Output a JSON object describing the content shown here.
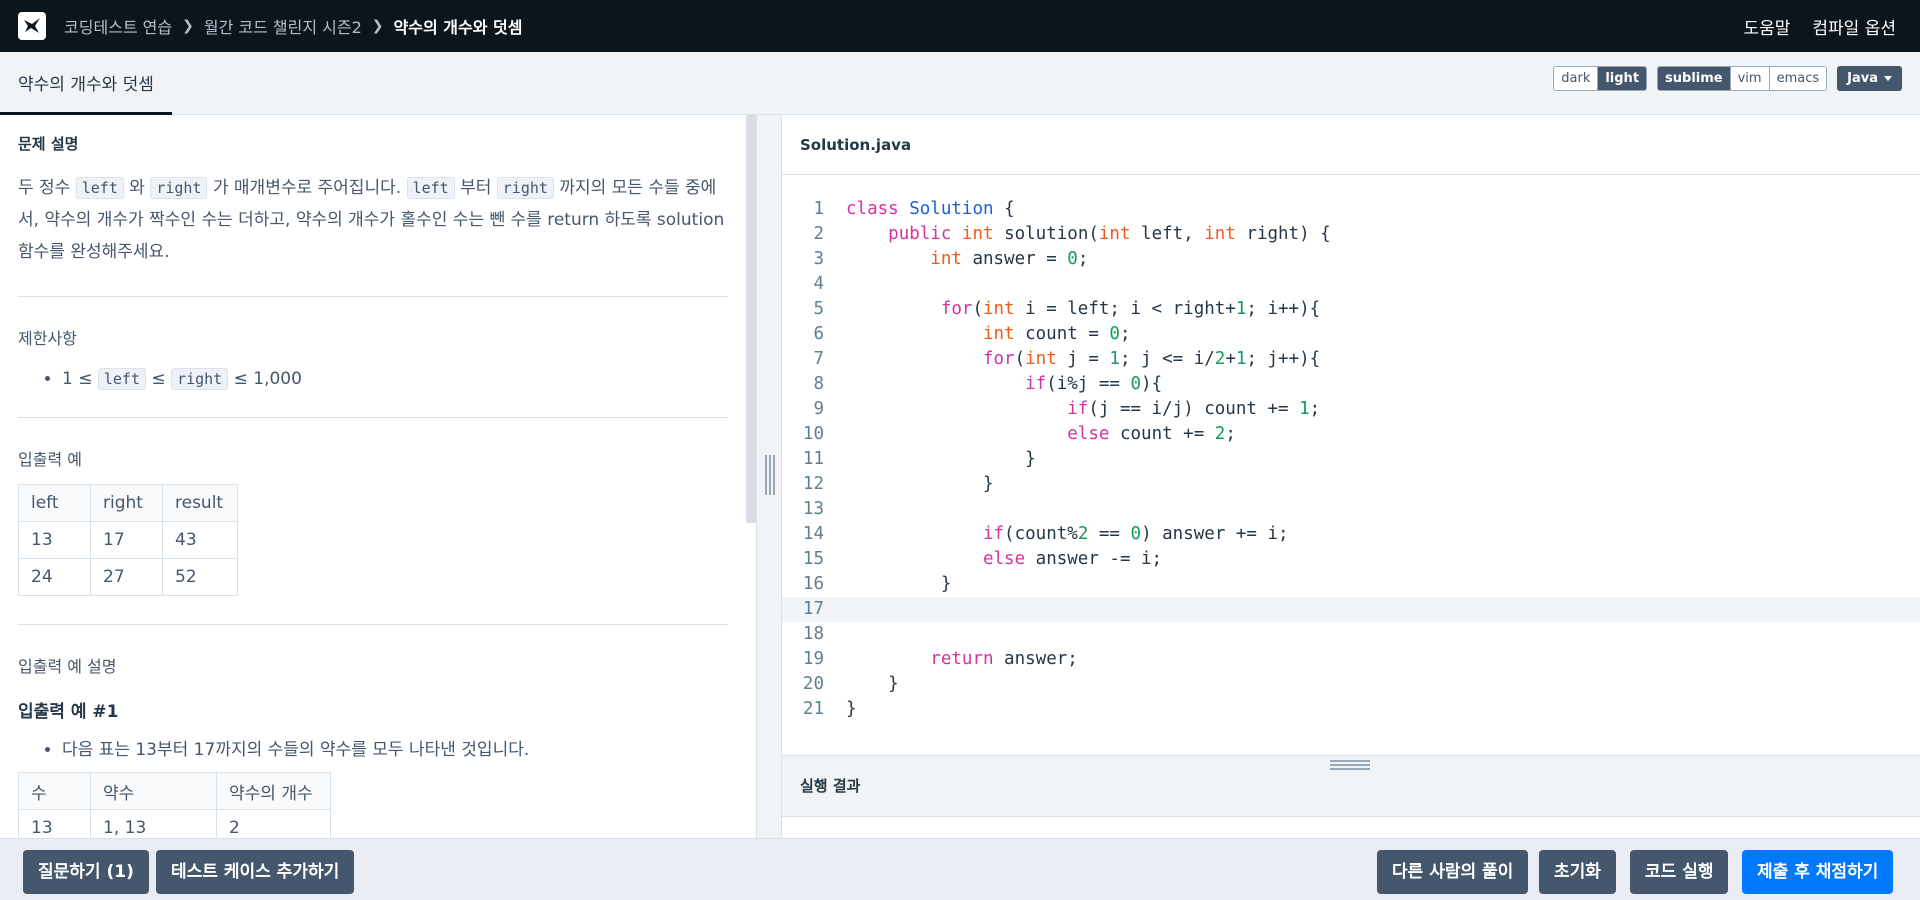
{
  "nav": {
    "crumbs": [
      "코딩테스트 연습",
      "월간 코드 챌린지 시즌2",
      "약수의 개수와 덧셈"
    ],
    "help": "도움말",
    "compile_options": "컴파일 옵션"
  },
  "tabbar": {
    "active_tab": "약수의 개수와 덧셈",
    "themes": [
      "dark",
      "light"
    ],
    "keymaps": [
      "sublime",
      "vim",
      "emacs"
    ],
    "language": "Java"
  },
  "problem": {
    "section_title": "문제 설명",
    "desc": {
      "p1": "두 정수",
      "c1": "left",
      "p2": "와",
      "c2": "right",
      "p3": "가 매개변수로 주어집니다.",
      "c3": "left",
      "p4": "부터",
      "c4": "right",
      "p5": "까지의 모든 수들 중에서, 약수의 개수가 짝수인 수는 더하고, 약수의 개수가 홀수인 수는 뺀 수를 return 하도록 solution 함수를 완성해주세요."
    },
    "constraints_title": "제한사항",
    "constraint": {
      "a": "1 ≤",
      "c1": "left",
      "b": "≤",
      "c2": "right",
      "c": "≤ 1,000"
    },
    "io_title": "입출력 예",
    "io_table": [
      [
        "left",
        "right",
        "result"
      ],
      [
        "13",
        "17",
        "43"
      ],
      [
        "24",
        "27",
        "52"
      ]
    ],
    "io_desc_title": "입출력 예 설명",
    "example1_title": "입출력 예 #1",
    "example1_bullet": "다음 표는 13부터 17까지의 수들의 약수를 모두 나타낸 것입니다.",
    "div_table": [
      [
        "수",
        "약수",
        "약수의 개수"
      ],
      [
        "13",
        "1, 13",
        "2"
      ]
    ]
  },
  "editor": {
    "filename": "Solution.java",
    "line_numbers": [
      "1",
      "2",
      "3",
      "4",
      "5",
      "6",
      "7",
      "8",
      "9",
      "10",
      "11",
      "12",
      "13",
      "14",
      "15",
      "16",
      "17",
      "18",
      "19",
      "20",
      "21"
    ],
    "highlighted_line": 17
  },
  "result": {
    "title": "실행 결과"
  },
  "bottom": {
    "question": "질문하기 (1)",
    "add_testcase": "테스트 케이스 추가하기",
    "others_solution": "다른 사람의 풀이",
    "reset": "초기화",
    "run": "코드 실행",
    "submit": "제출 후 채점하기"
  },
  "colors": {
    "nav_bg": "#0c151c",
    "button_bg": "#44576c",
    "primary": "#0078ff",
    "keyword": "#d632a0",
    "type": "#f05a1a",
    "class": "#1f5fd1",
    "number": "#0f9d58"
  },
  "icons": [
    "programmers-logo-icon",
    "chevron-right-icon",
    "caret-down-icon",
    "vertical-grip-icon",
    "horizontal-grip-icon"
  ]
}
